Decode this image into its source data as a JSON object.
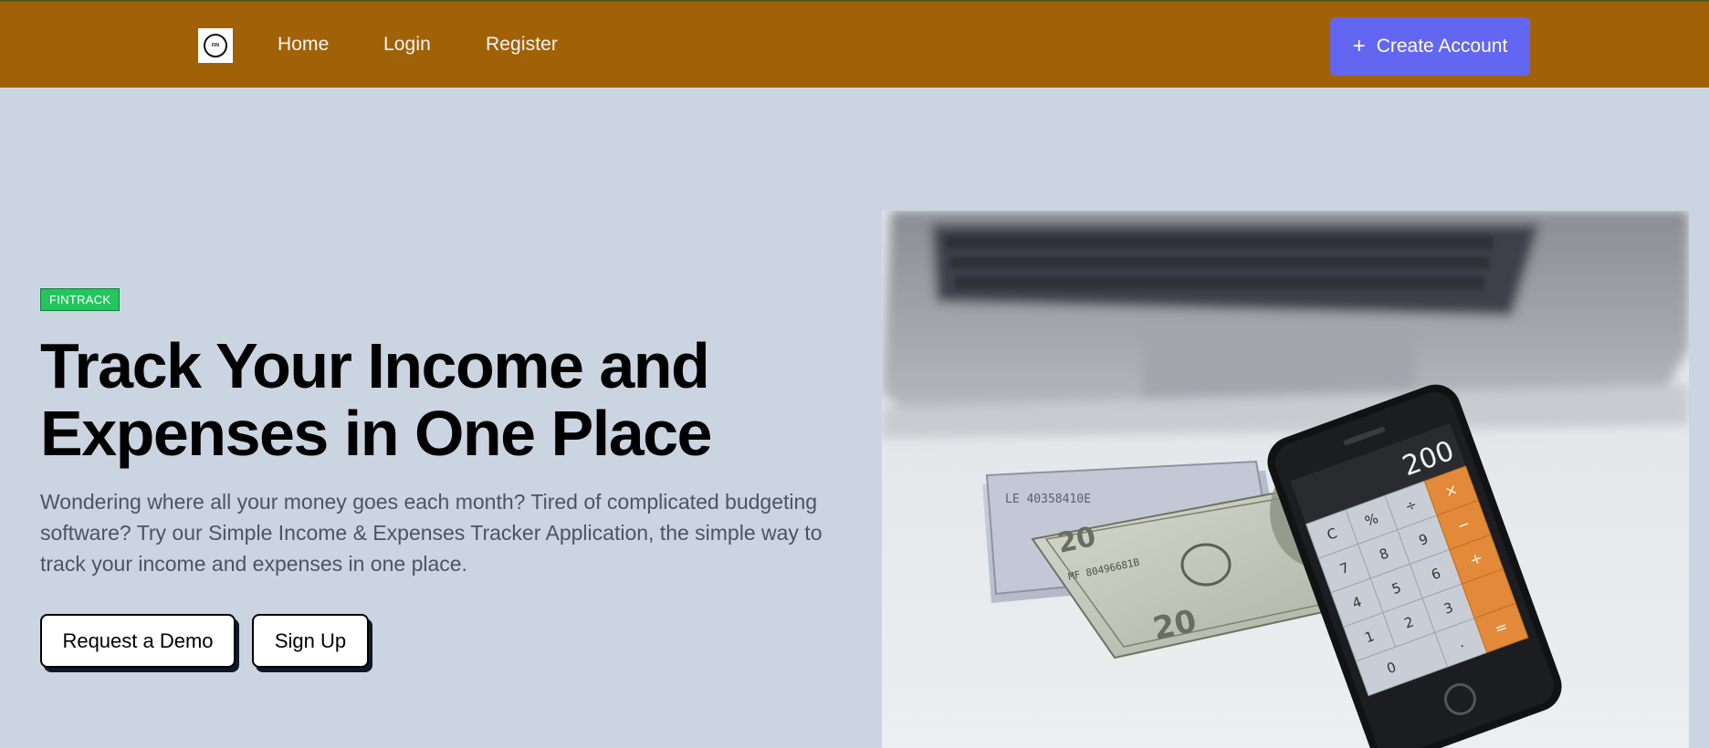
{
  "header": {
    "logo_alt": "logo",
    "logo_text": "FIN",
    "nav": [
      {
        "label": "Home"
      },
      {
        "label": "Login"
      },
      {
        "label": "Register"
      }
    ],
    "cta_label": "Create Account",
    "cta_icon": "plus-icon"
  },
  "hero": {
    "badge": "FINTRACK",
    "title_line1": "Track Your Income and",
    "title_line2": "Expenses in One Place",
    "description": "Wondering where all your money goes each month? Tired of complicated budgeting software? Try our Simple Income & Expenses Tracker Application, the simple way to track your income and expenses in one place.",
    "buttons": [
      {
        "label": "Request a Demo"
      },
      {
        "label": "Sign Up"
      }
    ],
    "image": {
      "subject": "laptop, dollar bills and a smartphone calculator on a desk",
      "calculator_display": "200",
      "calculator_keys": [
        "C",
        "%",
        "÷",
        "×",
        "7",
        "8",
        "9",
        "−",
        "4",
        "5",
        "6",
        "+",
        "1",
        "2",
        "3",
        "=",
        "0",
        "."
      ]
    }
  },
  "colors": {
    "navbar": "#a16207",
    "page_bg": "#cbd5e1",
    "cta": "#6366f1",
    "badge": "#22c55e",
    "description_text": "#4b5563"
  }
}
